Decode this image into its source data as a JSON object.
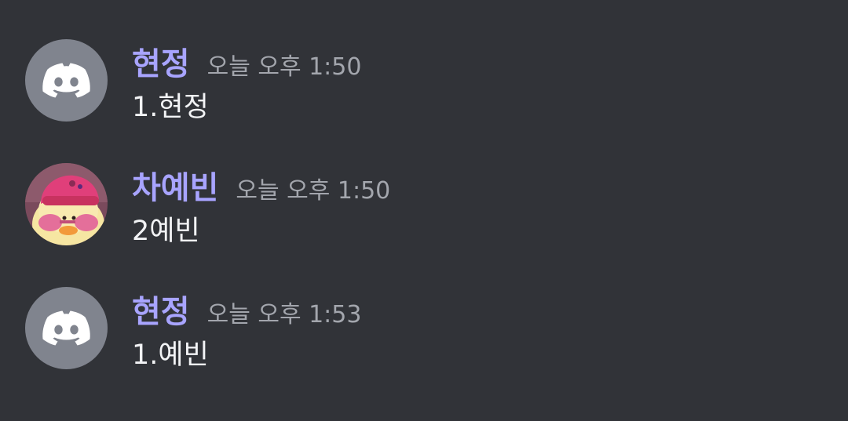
{
  "messages": [
    {
      "author": "현정",
      "avatar_icon": "discord-logo-icon",
      "timestamp": "오늘 오후 1:50",
      "content": "1.현정"
    },
    {
      "author": "차예빈",
      "avatar_icon": "duck-photo-avatar",
      "timestamp": "오늘 오후 1:50",
      "content": "2예빈"
    },
    {
      "author": "현정",
      "avatar_icon": "discord-logo-icon",
      "timestamp": "오늘 오후 1:53",
      "content": "1.예빈"
    }
  ],
  "colors": {
    "background": "#313338",
    "username": "#a8a4ff",
    "timestamp": "#a3a6ad",
    "content": "#f2f3f5",
    "default_avatar": "#80848e"
  }
}
